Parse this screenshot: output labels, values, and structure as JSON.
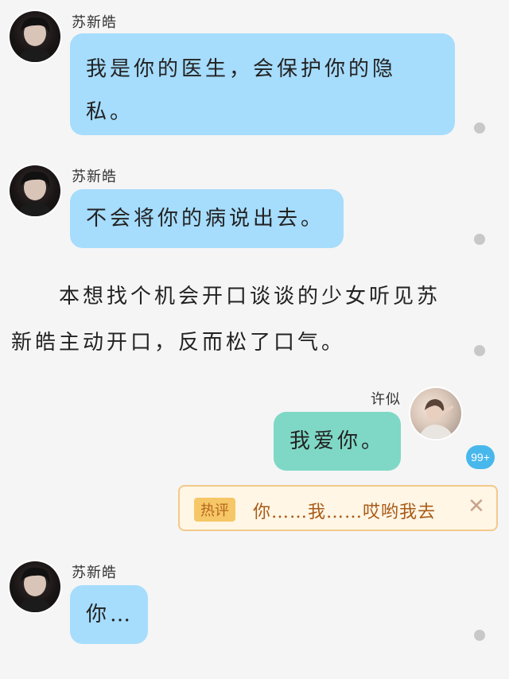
{
  "messages": [
    {
      "sender": "苏新皓",
      "text": "我是你的医生，会保护你的隐私。"
    },
    {
      "sender": "苏新皓",
      "text": "不会将你的病说出去。"
    },
    {
      "narration": "本想找个机会开口谈谈的少女听见苏新皓主动开口，反而松了口气。"
    },
    {
      "sender": "许似",
      "text": "我爱你。"
    },
    {
      "sender": "苏新皓",
      "text": "你…"
    }
  ],
  "comment_badge": "99+",
  "hot_comment": {
    "tag": "热评",
    "text": "你……我……哎哟我去",
    "close_icon": "close-icon"
  },
  "colors": {
    "left_bubble": "#a6dcfc",
    "right_bubble": "#7fd8c6",
    "badge": "#48b7ec",
    "hot_border": "#f3c98b"
  }
}
